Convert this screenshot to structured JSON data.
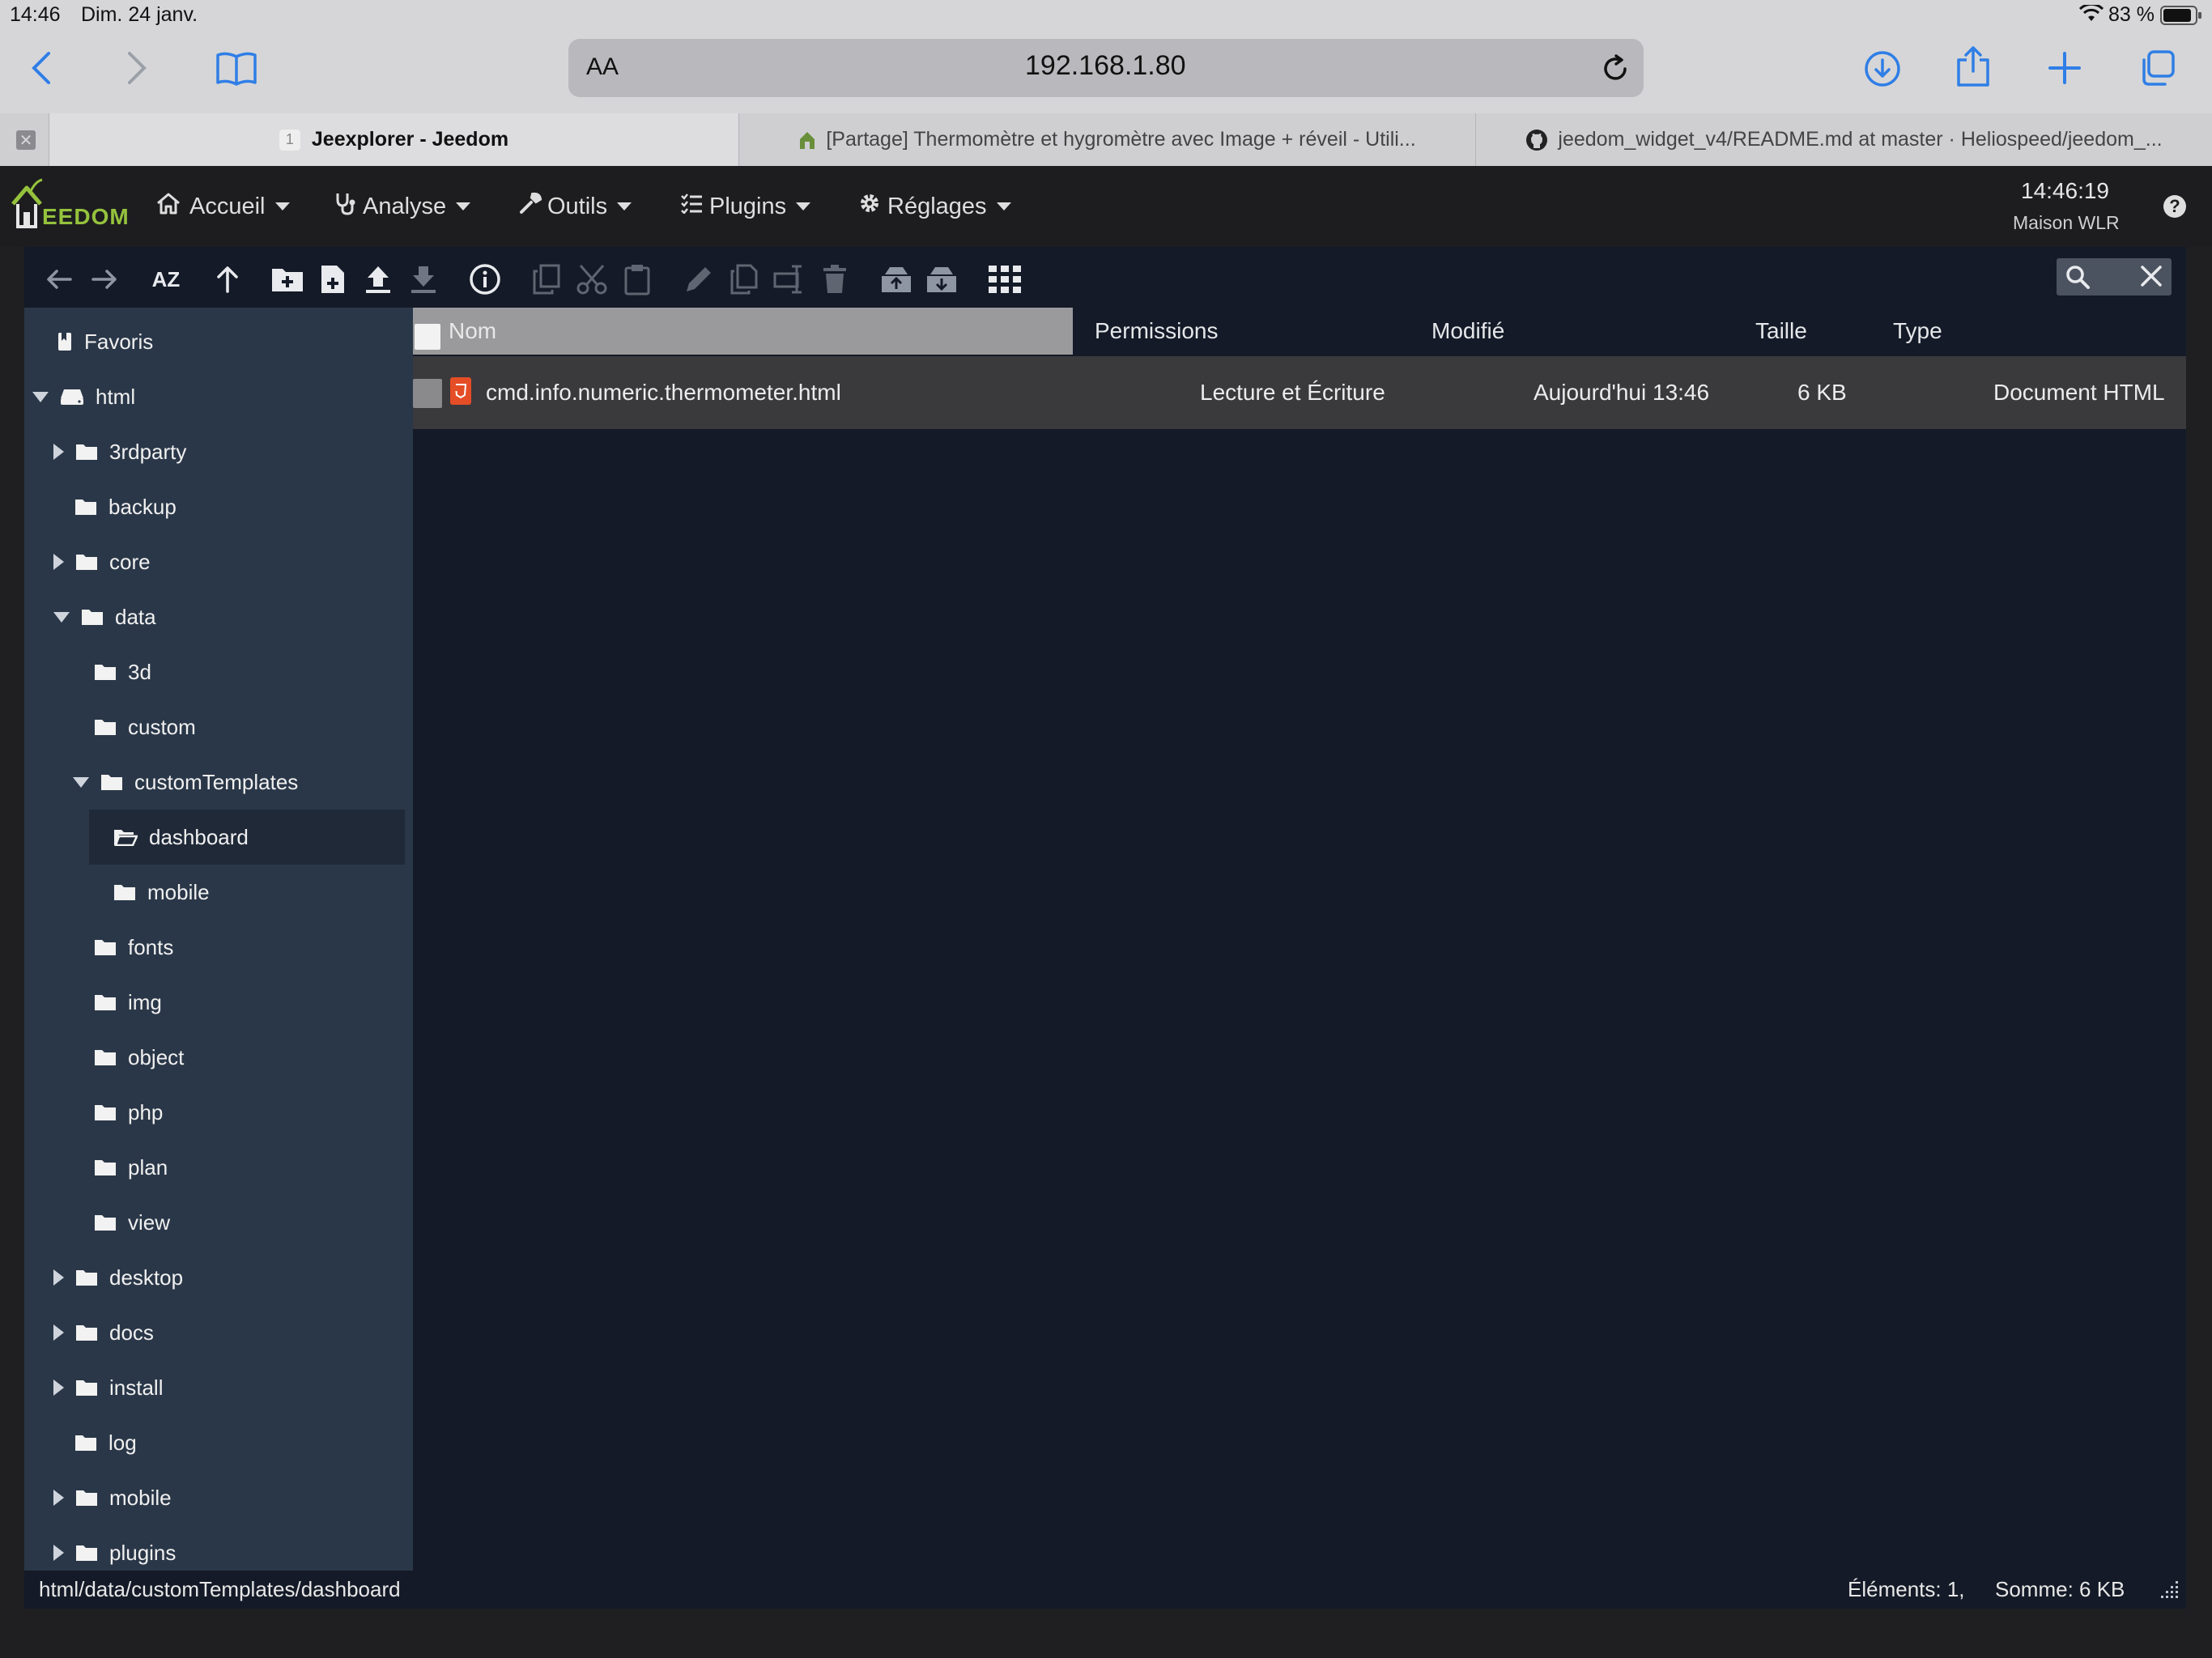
{
  "status_bar": {
    "time": "14:46",
    "date": "Dim. 24 janv.",
    "battery": "83 %"
  },
  "safari": {
    "url": "192.168.1.80",
    "reader_label": "AA",
    "tabs": [
      {
        "label": "Jeexplorer - Jeedom",
        "badge": "1"
      },
      {
        "label": "[Partage] Thermomètre et hygromètre avec Image + réveil - Utili..."
      },
      {
        "label": "jeedom_widget_v4/README.md at master · Heliospeed/jeedom_..."
      }
    ]
  },
  "jeedom": {
    "logo_text": "EEDOM",
    "menu": [
      "Accueil",
      "Analyse",
      "Outils",
      "Plugins",
      "Réglages"
    ],
    "clock": "14:46:19",
    "home_name": "Maison WLR",
    "help_icon": "question-circle-icon"
  },
  "explorer": {
    "sort_label": "AZ",
    "tree": [
      {
        "label": "Favoris",
        "depth": 0,
        "toggle": "none",
        "icon": "bookmark-icon"
      },
      {
        "label": "html",
        "depth": 0,
        "toggle": "open",
        "icon": "drive-icon"
      },
      {
        "label": "3rdparty",
        "depth": 1,
        "toggle": "closed",
        "icon": "folder-icon"
      },
      {
        "label": "backup",
        "depth": 1,
        "toggle": "none",
        "icon": "folder-icon"
      },
      {
        "label": "core",
        "depth": 1,
        "toggle": "closed",
        "icon": "folder-icon"
      },
      {
        "label": "data",
        "depth": 1,
        "toggle": "open",
        "icon": "folder-icon"
      },
      {
        "label": "3d",
        "depth": 2,
        "toggle": "none",
        "icon": "folder-icon"
      },
      {
        "label": "custom",
        "depth": 2,
        "toggle": "none",
        "icon": "folder-icon"
      },
      {
        "label": "customTemplates",
        "depth": 2,
        "toggle": "open",
        "icon": "folder-icon"
      },
      {
        "label": "dashboard",
        "depth": 3,
        "toggle": "none",
        "icon": "folder-open-icon",
        "selected": true
      },
      {
        "label": "mobile",
        "depth": 3,
        "toggle": "none",
        "icon": "folder-icon"
      },
      {
        "label": "fonts",
        "depth": 2,
        "toggle": "none",
        "icon": "folder-icon"
      },
      {
        "label": "img",
        "depth": 2,
        "toggle": "none",
        "icon": "folder-icon"
      },
      {
        "label": "object",
        "depth": 2,
        "toggle": "none",
        "icon": "folder-icon"
      },
      {
        "label": "php",
        "depth": 2,
        "toggle": "none",
        "icon": "folder-icon"
      },
      {
        "label": "plan",
        "depth": 2,
        "toggle": "none",
        "icon": "folder-icon"
      },
      {
        "label": "view",
        "depth": 2,
        "toggle": "none",
        "icon": "folder-icon"
      },
      {
        "label": "desktop",
        "depth": 1,
        "toggle": "closed",
        "icon": "folder-icon"
      },
      {
        "label": "docs",
        "depth": 1,
        "toggle": "closed",
        "icon": "folder-icon"
      },
      {
        "label": "install",
        "depth": 1,
        "toggle": "closed",
        "icon": "folder-icon"
      },
      {
        "label": "log",
        "depth": 1,
        "toggle": "none",
        "icon": "folder-icon"
      },
      {
        "label": "mobile",
        "depth": 1,
        "toggle": "closed",
        "icon": "folder-icon"
      },
      {
        "label": "plugins",
        "depth": 1,
        "toggle": "closed",
        "icon": "folder-icon"
      }
    ],
    "columns": {
      "name": "Nom",
      "permissions": "Permissions",
      "modified": "Modifié",
      "size": "Taille",
      "type": "Type"
    },
    "files": [
      {
        "name": "cmd.info.numeric.thermometer.html",
        "permissions": "Lecture et Écriture",
        "modified": "Aujourd'hui 13:46",
        "size": "6 KB",
        "type": "Document HTML"
      }
    ],
    "path": "html/data/customTemplates/dashboard",
    "elements": "Éléments: 1,",
    "sum": "Somme: 6 KB"
  }
}
